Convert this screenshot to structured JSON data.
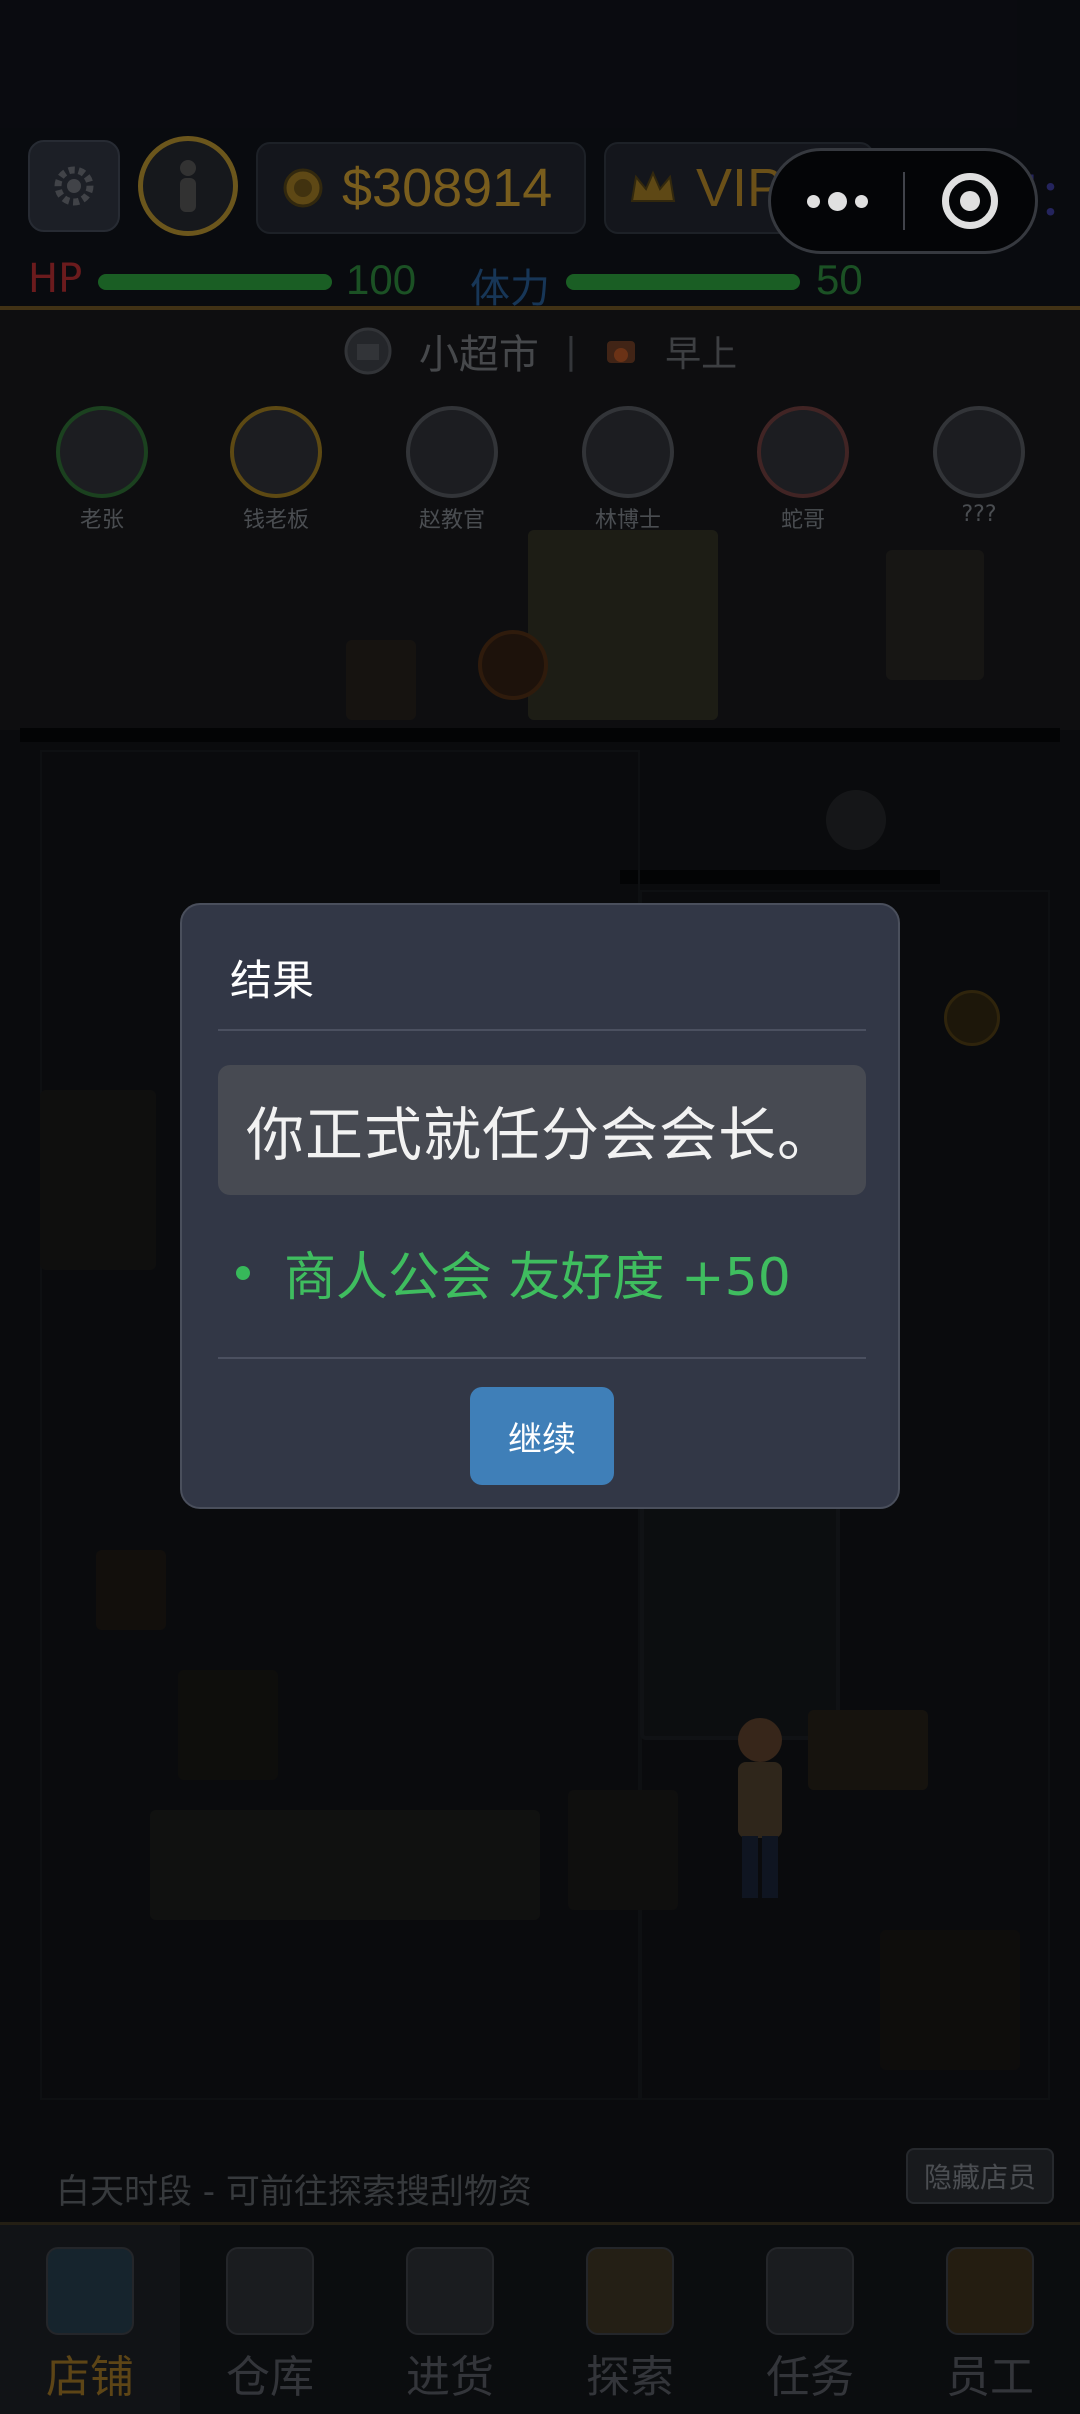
{
  "hud": {
    "money": "$308914",
    "vip": "VIP 10",
    "reputation_label": "声望：",
    "hp": {
      "label": "HP",
      "value": "100",
      "fill": 1.0,
      "color": "#7a1f22"
    },
    "stamina": {
      "label": "体力",
      "value": "50",
      "fill": 1.0,
      "color": "#1b3e63"
    }
  },
  "scene": {
    "location": "小超市",
    "divider": "|",
    "time_of_day": "早上",
    "npcs": [
      {
        "name": "老张"
      },
      {
        "name": "钱老板"
      },
      {
        "name": "赵教官"
      },
      {
        "name": "林博士"
      },
      {
        "name": "蛇哥"
      },
      {
        "name": "???"
      }
    ],
    "hint": "白天时段 - 可前往探索搜刮物资",
    "hide_staff_label": "隐藏店员"
  },
  "nav": {
    "items": [
      {
        "label": "店铺",
        "active": true
      },
      {
        "label": "仓库",
        "active": false
      },
      {
        "label": "进货",
        "active": false
      },
      {
        "label": "探索",
        "active": false
      },
      {
        "label": "任务",
        "active": false
      },
      {
        "label": "员工",
        "active": false
      }
    ]
  },
  "dialog": {
    "title": "结果",
    "message": "你正式就任分会会长。",
    "effect": "商人公会 友好度 +50",
    "continue_label": "继续"
  },
  "colors": {
    "dialog_bg": "#323746",
    "effect_green": "#3fbd5f",
    "button_blue": "#3f7fb8",
    "gold": "#8a6a22"
  }
}
